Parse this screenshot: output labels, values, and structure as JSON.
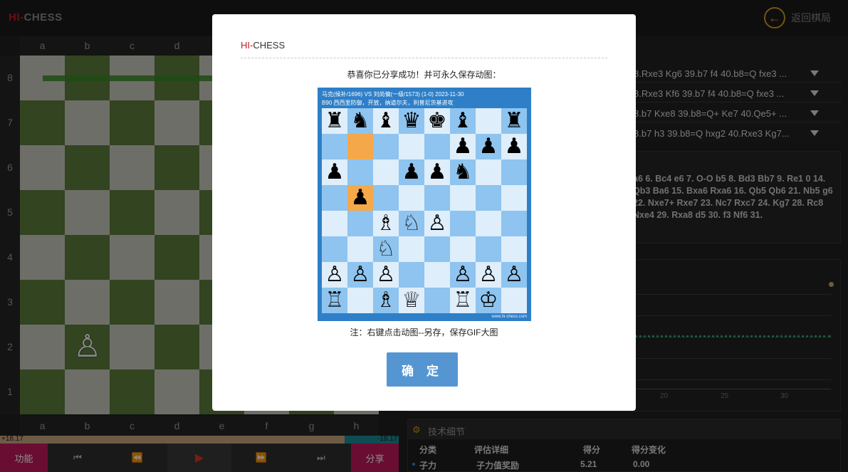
{
  "header": {
    "logo_hi": "HI-",
    "logo_chess": "CHESS",
    "back_label": "返回棋局"
  },
  "board": {
    "files": [
      "a",
      "b",
      "c",
      "d",
      "e",
      "f",
      "g",
      "h"
    ],
    "ranks": [
      "8",
      "7",
      "6",
      "5",
      "4",
      "3",
      "2",
      "1"
    ],
    "eval_left": "+18.17",
    "eval_right": "-18.17"
  },
  "controls": {
    "func_label": "功能",
    "share_label": "分享"
  },
  "variations": [
    {
      "text": "8.Rxe3 Kg6 39.b7 f4 40.b8=Q fxe3 ..."
    },
    {
      "text": "8.Rxe3 Kf6 39.b7 f4 40.b8=Q fxe3 ..."
    },
    {
      "text": "8.b7 Kxe8 39.b8=Q+ Ke7 40.Qe5+ ..."
    },
    {
      "text": "8.b7 h3 39.b8=Q hxg2 40.Rxe3 Kg7..."
    }
  ],
  "moves_text": "a6 6. Bc4 e6 7. O-O b5 8. Bd3 Bb7 9. Re1 0 14. Qb3 Ba6 15. Bxa6 Rxa6 16. Qb5 Qb6 21. Nb5 g6 22. Nxe7+ Rxe7 23. Nc7 Rxc7 24. Kg7 28. Rc8 Nxe4 29. Rxa8 d5 30. f3 Nf6 31.",
  "graph": {
    "ticks": [
      "20",
      "25",
      "30"
    ]
  },
  "details": {
    "title": "技术细节",
    "columns": [
      "分类",
      "评估详细",
      "得分",
      "得分变化"
    ],
    "row": {
      "category": "子力",
      "detail": "子力值奖励",
      "score": "5.21",
      "change": "0.00"
    }
  },
  "modal": {
    "logo_hi": "HI-",
    "logo_chess": "CHESS",
    "message": "恭喜你已分享成功！并可永久保存动图：",
    "gif_line1": "马克(候补/1696) VS 刘尚偏(一级/1573) (1-0) 2023-11-30",
    "gif_line2": "B90 西西里防御，开放，纳道尔夫，利普尼茨基进攻",
    "gif_watermark": "www.hi-chess.com",
    "note": "注：右键点击动图--另存，保存GIF大图",
    "confirm_label": "确 定"
  },
  "gif_position": [
    [
      "♜",
      "♞",
      "♝",
      "♛",
      "♚",
      "♝",
      "",
      "♜"
    ],
    [
      "",
      "",
      "",
      "",
      "",
      "♟",
      "♟",
      "♟"
    ],
    [
      "♟",
      "",
      "",
      "♟",
      "♟",
      "♞",
      "",
      ""
    ],
    [
      "",
      "♟",
      "",
      "",
      "",
      "",
      "",
      ""
    ],
    [
      "",
      "",
      "♗",
      "♘",
      "♙",
      "",
      "",
      ""
    ],
    [
      "",
      "",
      "♘",
      "",
      "",
      "",
      "",
      ""
    ],
    [
      "♙",
      "♙",
      "♙",
      "",
      "",
      "♙",
      "♙",
      "♙"
    ],
    [
      "♖",
      "",
      "♗",
      "♕",
      "",
      "♖",
      "♔",
      ""
    ]
  ],
  "colors": {
    "brand_red": "#c8181e",
    "accent_magenta": "#c2185b",
    "confirm_blue": "#5596d2",
    "board_dark": "#5b7c3b",
    "board_light": "#c8c9bf",
    "highlight_orange": "#f5a84a"
  }
}
